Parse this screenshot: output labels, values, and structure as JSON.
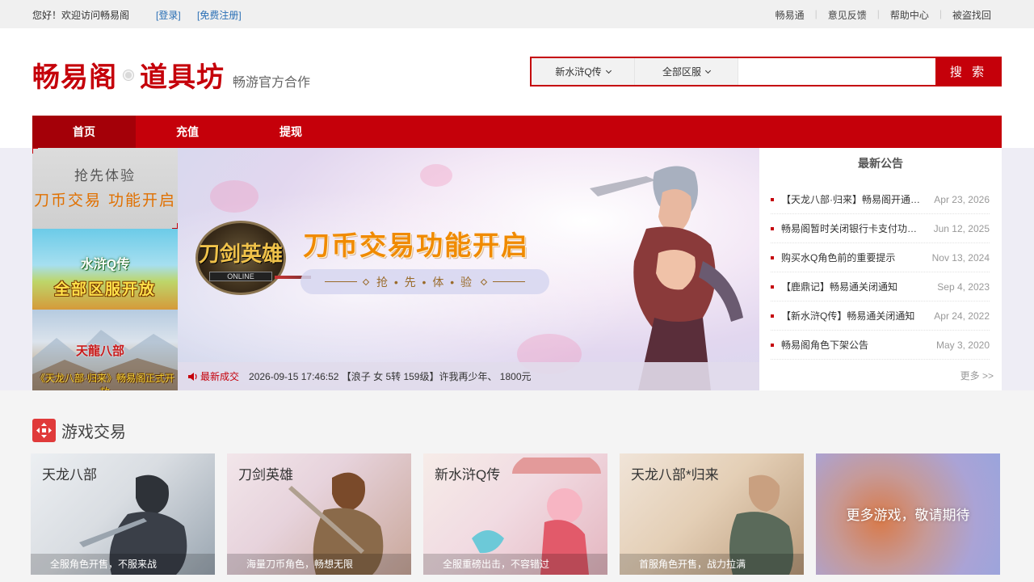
{
  "topbar": {
    "welcome": "您好！欢迎访问畅易阁",
    "login": "[登录]",
    "register": "[免费注册]",
    "links": [
      "畅易通",
      "意见反馈",
      "帮助中心",
      "被盗找回"
    ]
  },
  "header": {
    "brand_left": "畅易阁",
    "brand_right": "道具坊",
    "tagline": "畅游官方合作"
  },
  "search": {
    "game_select": "新水浒Q传",
    "server_select": "全部区服",
    "input_value": "",
    "button": "搜 索"
  },
  "nav": {
    "items": [
      "首页",
      "充值",
      "提现"
    ],
    "active": "首页"
  },
  "promos": {
    "p1_line1": "抢先体验",
    "p1_line2": "刀币交易  功能开启",
    "p2_line1": "水浒Q传",
    "p2_line2": "全部区服开放",
    "p3_line1": "天龍八部",
    "p3_line2": "《天龙八部·归来》畅易阁正式开放"
  },
  "banner": {
    "logo_text": "刀剑英雄",
    "logo_sub": "ONLINE",
    "headline": "刀币交易功能开启",
    "subline": "抢 • 先 • 体 • 验"
  },
  "latest_deal": {
    "label": "最新成交",
    "text": "2026-09-15 17:46:52 【浪子 女 5转 159级】许我再少年、 1800元"
  },
  "notices": {
    "title": "最新公告",
    "items": [
      {
        "title": "【天龙八部·归来】畅易阁开通手机交易",
        "date": "Apr 23, 2026"
      },
      {
        "title": "畅易阁暂时关闭银行卡支付功能公告",
        "date": "Jun 12, 2025"
      },
      {
        "title": "购买水Q角色前的重要提示",
        "date": "Nov 13, 2024"
      },
      {
        "title": "【鹿鼎记】畅易通关闭通知",
        "date": "Sep 4, 2023"
      },
      {
        "title": "【新水浒Q传】畅易通关闭通知",
        "date": "Apr 24, 2022"
      },
      {
        "title": "畅易阁角色下架公告",
        "date": "May 3, 2020"
      }
    ],
    "more": "更多 >>"
  },
  "games": {
    "section_title": "游戏交易",
    "cards": [
      {
        "name": "天龙八部",
        "caption": "全服角色开售，不服来战"
      },
      {
        "name": "刀剑英雄",
        "caption": "海量刀币角色，畅想无限"
      },
      {
        "name": "新水浒Q传",
        "caption": "全服重磅出击，不容错过"
      },
      {
        "name": "天龙八部*归来",
        "caption": "首服角色开售，战力拉满"
      }
    ],
    "more_card": "更多游戏，敬请期待"
  },
  "colors": {
    "brand_red": "#c5000a",
    "nav_active": "#a40008",
    "link_blue": "#2a6fb5"
  }
}
